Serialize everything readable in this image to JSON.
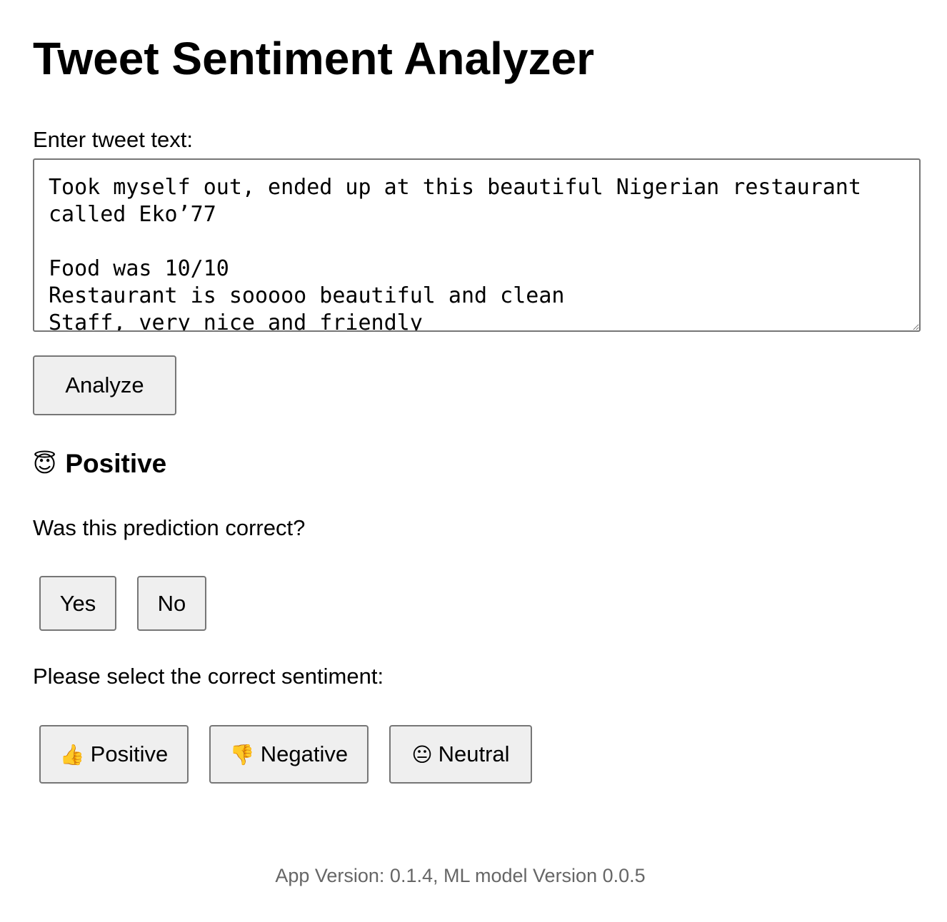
{
  "page": {
    "title": "Tweet Sentiment Analyzer"
  },
  "form": {
    "label": "Enter tweet text:",
    "tweet_text": "Took myself out, ended up at this beautiful Nigerian restaurant called Eko’77\n\nFood was 10/10\nRestaurant is sooooo beautiful and clean\nStaff, very nice and friendly",
    "analyze_label": "Analyze"
  },
  "result": {
    "emoji": "😇",
    "label": "Positive"
  },
  "feedback": {
    "question": "Was this prediction correct?",
    "yes_label": "Yes",
    "no_label": "No",
    "select_prompt": "Please select the correct sentiment:",
    "options": [
      {
        "icon": "👍",
        "label": "Positive"
      },
      {
        "icon": "👎",
        "label": "Negative"
      },
      {
        "icon": "😐",
        "label": "Neutral"
      }
    ]
  },
  "footer": {
    "version_text": "App Version: 0.1.4, ML model Version 0.0.5"
  }
}
